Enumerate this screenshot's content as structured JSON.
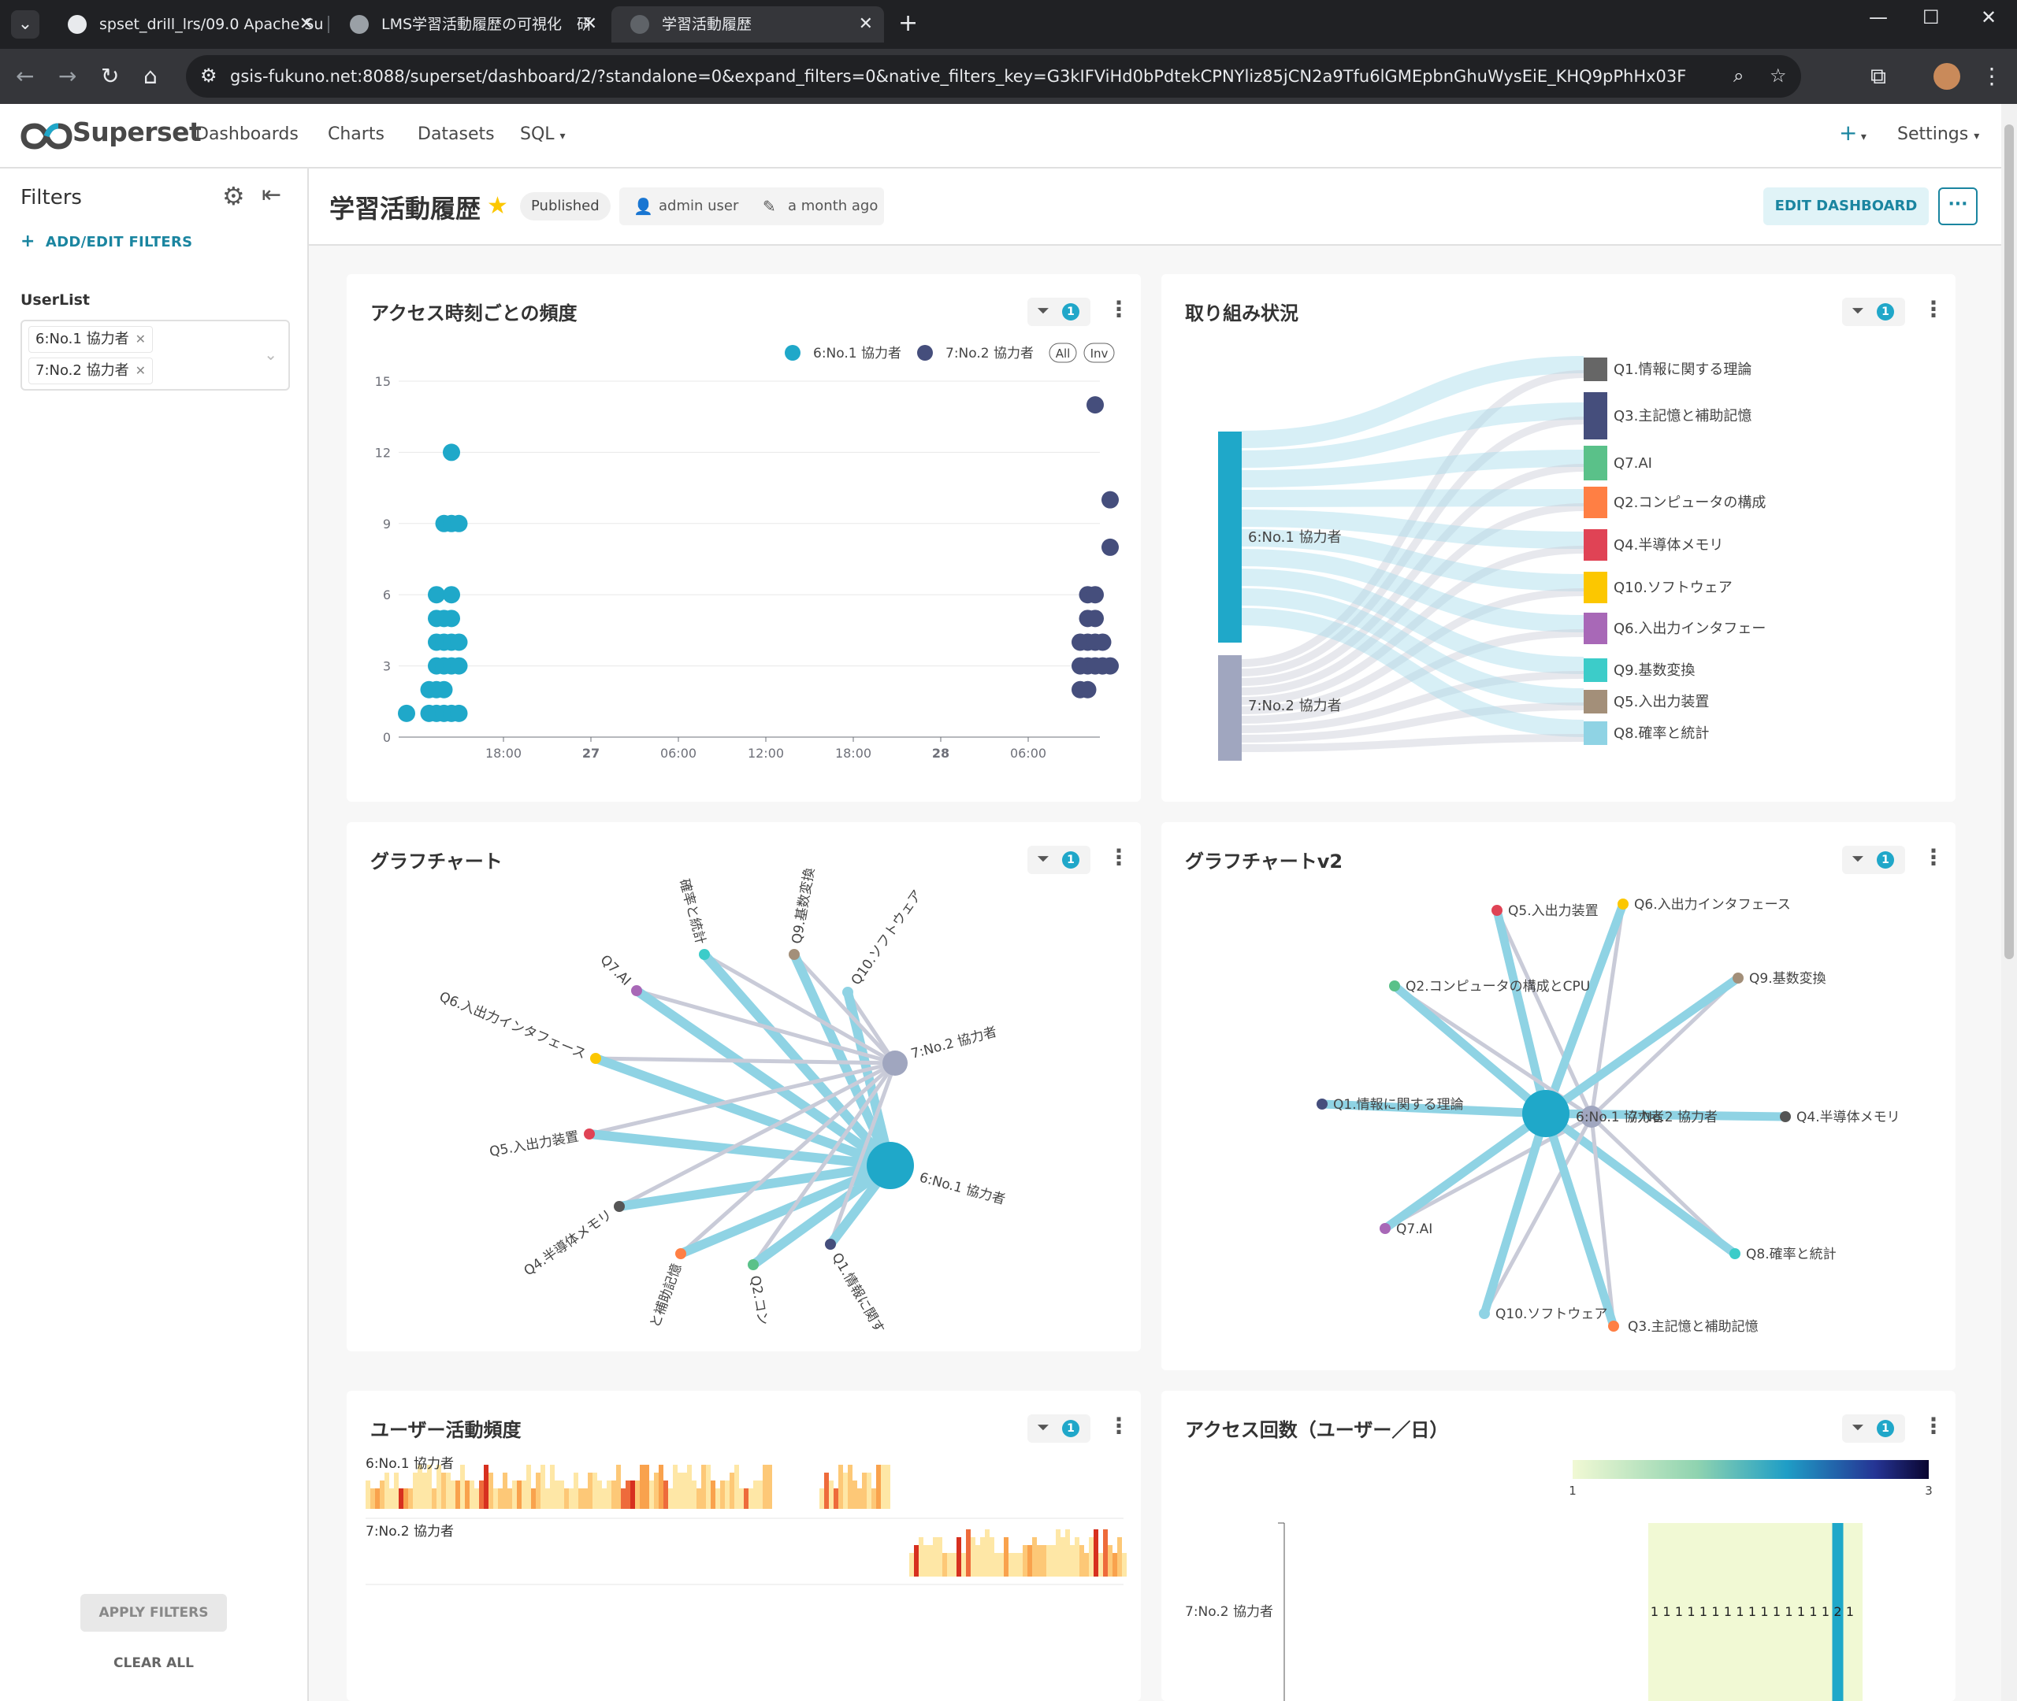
{
  "browser": {
    "tabs": [
      {
        "title": "spset_drill_lrs/09.0 Apache Supe",
        "active": false
      },
      {
        "title": "LMS学習活動履歴の可視化　研",
        "active": false
      },
      {
        "title": "学習活動履歴",
        "active": true
      }
    ],
    "url": "gsis-fukuno.net:8088/superset/dashboard/2/?standalone=0&expand_filters=0&native_filters_key=G3kIFViHd0bPdtekCPNYliz85jCN2a9Tfu6lGMEpbnGhuWysEiE_KHQ9pPhHx03F"
  },
  "superset": {
    "brand": "Superset",
    "nav": [
      "Dashboards",
      "Charts",
      "Datasets",
      "SQL"
    ],
    "plus": "+",
    "settings": "Settings"
  },
  "filters": {
    "title": "Filters",
    "add_edit": "ADD/EDIT FILTERS",
    "userlist_label": "UserList",
    "selected": [
      "6:No.1 協力者",
      "7:No.2 協力者"
    ],
    "apply": "APPLY FILTERS",
    "clear": "CLEAR ALL"
  },
  "dashboard": {
    "title": "学習活動履歴",
    "status": "Published",
    "owner": "admin user",
    "modified": "a month ago",
    "edit": "EDIT DASHBOARD",
    "more": "···"
  },
  "colors": {
    "series1": "#1fa8c9",
    "series2": "#454e7c"
  },
  "cards": {
    "scatter": {
      "title": "アクセス時刻ごとの頻度",
      "badge": "1"
    },
    "sankey": {
      "title": "取り組み状況",
      "badge": "1"
    },
    "graph1": {
      "title": "グラフチャート",
      "badge": "1"
    },
    "graph2": {
      "title": "グラフチャートv2",
      "badge": "1"
    },
    "heat": {
      "title": "ユーザー活動頻度",
      "badge": "1"
    },
    "access": {
      "title": "アクセス回数（ユーザー／日）",
      "badge": "1"
    }
  },
  "chart_data": [
    {
      "type": "scatter",
      "title": "アクセス時刻ごとの頻度",
      "legend": [
        "6:No.1 協力者",
        "7:No.2 協力者"
      ],
      "legend_buttons": [
        "All",
        "Inv"
      ],
      "x_ticks": [
        "18:00",
        "27",
        "06:00",
        "12:00",
        "18:00",
        "28",
        "06:00"
      ],
      "y_ticks": [
        0,
        3,
        6,
        9,
        12,
        15
      ],
      "ylim": [
        0,
        15
      ],
      "series": [
        {
          "name": "6:No.1 協力者",
          "points": [
            [
              0,
              1
            ],
            [
              6,
              12
            ],
            [
              5,
              9
            ],
            [
              6,
              9
            ],
            [
              7,
              9
            ],
            [
              4,
              6
            ],
            [
              6,
              6
            ],
            [
              4,
              5
            ],
            [
              5,
              5
            ],
            [
              6,
              5
            ],
            [
              4,
              4
            ],
            [
              5,
              4
            ],
            [
              6,
              4
            ],
            [
              7,
              4
            ],
            [
              4,
              3
            ],
            [
              5,
              3
            ],
            [
              6,
              3
            ],
            [
              7,
              3
            ],
            [
              3,
              2
            ],
            [
              4,
              2
            ],
            [
              5,
              2
            ],
            [
              3,
              1
            ],
            [
              4,
              1
            ],
            [
              5,
              1
            ],
            [
              6,
              1
            ],
            [
              7,
              1
            ]
          ]
        },
        {
          "name": "7:No.2 協力者",
          "points": [
            [
              92,
              14
            ],
            [
              94,
              10
            ],
            [
              94,
              8
            ],
            [
              91,
              6
            ],
            [
              92,
              6
            ],
            [
              91,
              5
            ],
            [
              92,
              5
            ],
            [
              90,
              4
            ],
            [
              91,
              4
            ],
            [
              92,
              4
            ],
            [
              93,
              4
            ],
            [
              90,
              3
            ],
            [
              91,
              3
            ],
            [
              92,
              3
            ],
            [
              93,
              3
            ],
            [
              94,
              3
            ],
            [
              90,
              2
            ],
            [
              91,
              2
            ]
          ]
        }
      ]
    },
    {
      "type": "sankey",
      "title": "取り組み状況",
      "sources": [
        "6:No.1 協力者",
        "7:No.2 協力者"
      ],
      "targets": [
        "Q1.情報に関する理論",
        "Q3.主記憶と補助記憶",
        "Q7.AI",
        "Q2.コンピュータの構成",
        "Q4.半導体メモリ",
        "Q10.ソフトウェア",
        "Q6.入出力インタフェー",
        "Q9.基数変換",
        "Q5.入出力装置",
        "Q8.確率と統計"
      ]
    },
    {
      "type": "graph",
      "title": "グラフチャート",
      "nodes": [
        "7:No.2 協力者",
        "6:No.1 協力者",
        "Q10.ソフトウェア",
        "Q9.基数変換",
        "確率と統計",
        "Q7.AI",
        "Q6.入出力インタフェース",
        "Q5.入出力装置",
        "Q4.半導体メモリ",
        "と補助記憶",
        "Q2.コン",
        "Q1.情報に関す"
      ]
    },
    {
      "type": "graph",
      "title": "グラフチャートv2",
      "nodes": [
        "6:No.1 協力者",
        "7:No.2 協力者",
        "Q5.入出力装置",
        "Q6.入出力インタフェース",
        "Q2.コンピュータの構成とCPU",
        "Q9.基数変換",
        "Q1.情報に関する理論",
        "Q4.半導体メモリ",
        "Q7.AI",
        "Q8.確率と統計",
        "Q10.ソフトウェア",
        "Q3.主記憶と補助記憶"
      ]
    },
    {
      "type": "heatmap",
      "title": "ユーザー活動頻度",
      "rows": [
        "6:No.1 協力者",
        "7:No.2 協力者"
      ]
    },
    {
      "type": "table",
      "title": "アクセス回数（ユーザー／日）",
      "colorbar": [
        "1",
        "3"
      ],
      "row_label": "7:No.2 協力者",
      "values": [
        1,
        1,
        1,
        1,
        1,
        1,
        1,
        1,
        1,
        1,
        1,
        1,
        1,
        1,
        1,
        2,
        1
      ]
    }
  ]
}
